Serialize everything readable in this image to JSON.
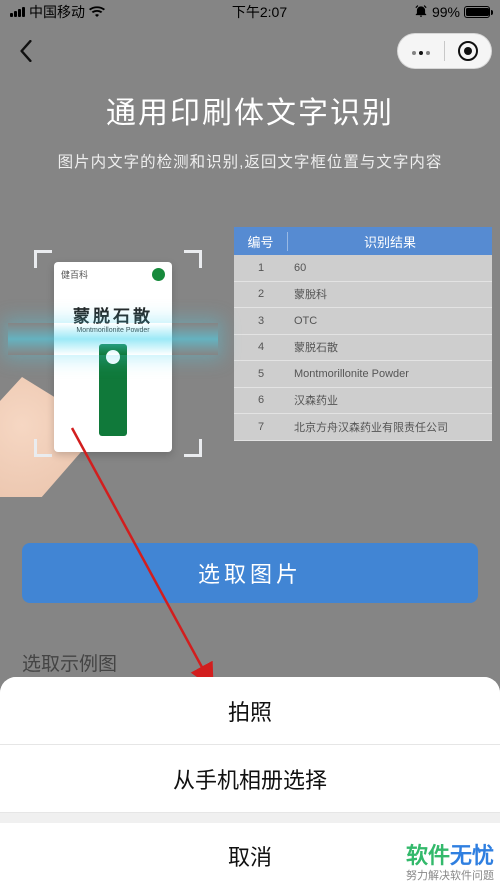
{
  "status": {
    "carrier": "中国移动",
    "time": "下午2:07",
    "battery_pct": "99%"
  },
  "page": {
    "title": "通用印刷体文字识别",
    "subtitle": "图片内文字的检测和识别,返回文字框位置与文字内容"
  },
  "sample_box": {
    "brand": "健百科",
    "name_zh": "蒙脱石散",
    "name_en": "Montmorillonite Powder"
  },
  "table": {
    "head_index": "编号",
    "head_value": "识别结果",
    "rows": [
      {
        "i": "1",
        "v": "60"
      },
      {
        "i": "2",
        "v": "蒙脫科"
      },
      {
        "i": "3",
        "v": "OTC"
      },
      {
        "i": "4",
        "v": "蒙脱石散"
      },
      {
        "i": "5",
        "v": "Montmorillonite Powder"
      },
      {
        "i": "6",
        "v": "汉森药业"
      },
      {
        "i": "7",
        "v": "北京方舟汉森药业有限责任公司"
      }
    ]
  },
  "controls": {
    "pick_image": "选取图片",
    "sample_section": "选取示例图"
  },
  "sheet": {
    "take_photo": "拍照",
    "from_album": "从手机相册选择",
    "cancel": "取消"
  },
  "watermark": {
    "line1a": "软件",
    "line1b": "无忧",
    "line2": "努力解决软件问题"
  }
}
